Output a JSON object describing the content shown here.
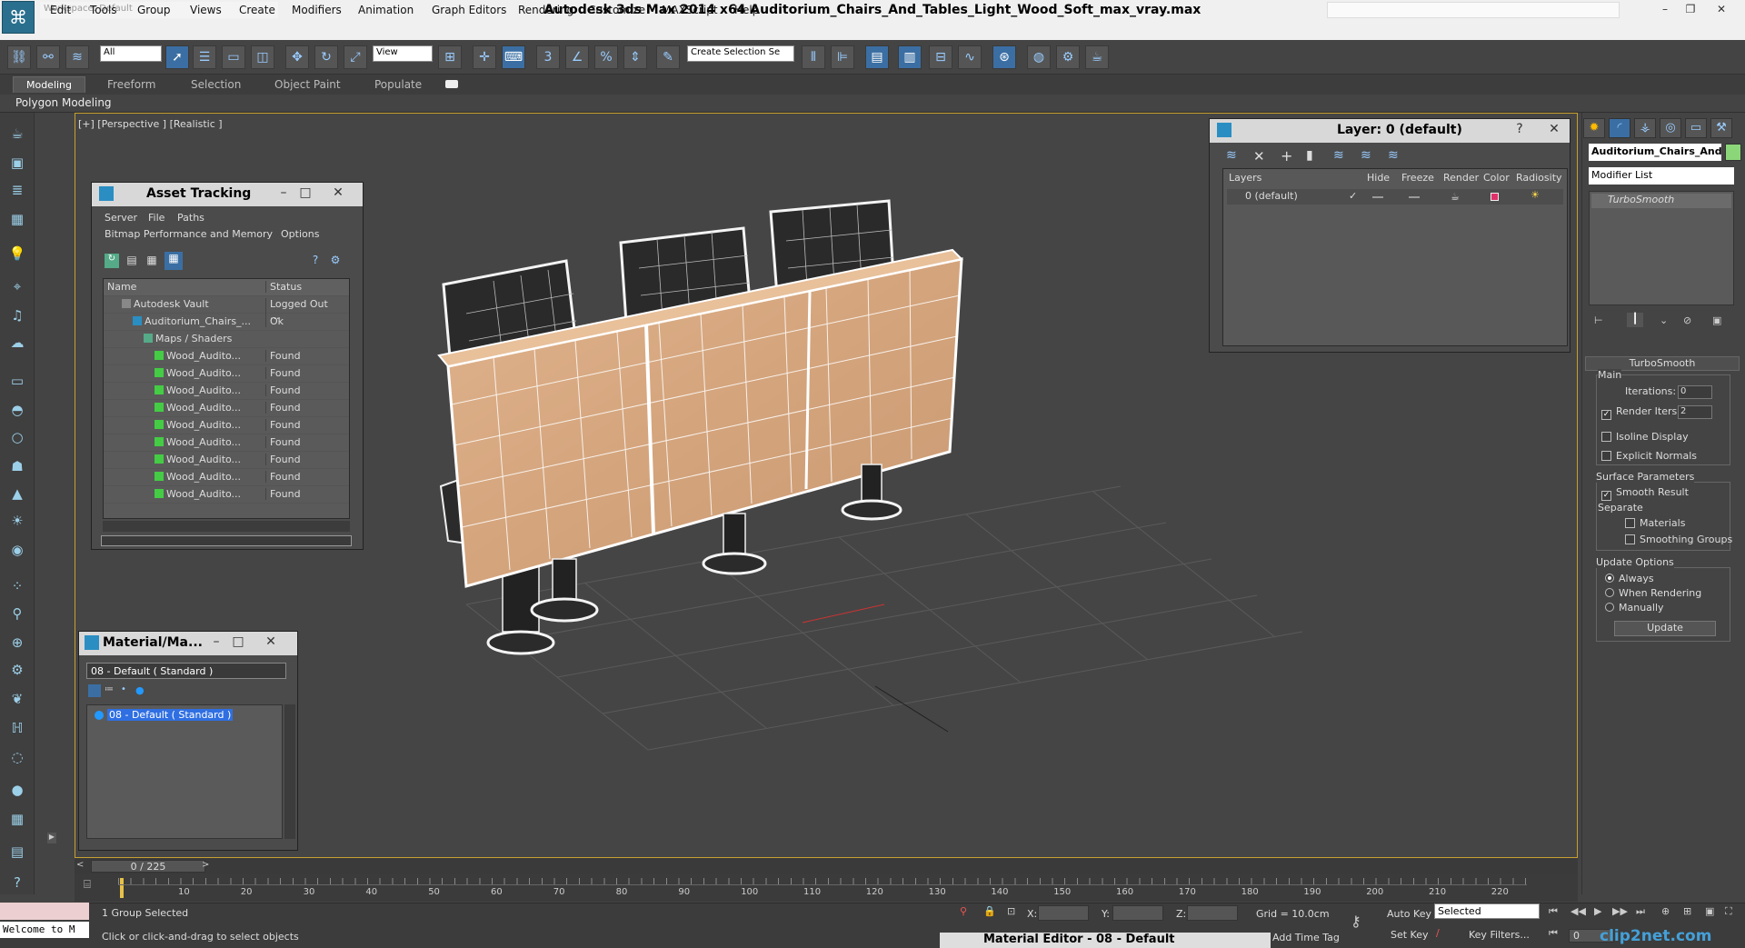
{
  "window": {
    "title": "Autodesk 3ds Max  2014 x64     Auditorium_Chairs_And_Tables_Light_Wood_Soft_max_vray.max",
    "workspace": "Workspace: Default",
    "controls": [
      "–",
      "❐",
      "✕"
    ]
  },
  "menubar": [
    "Edit",
    "Tools",
    "Group",
    "Views",
    "Create",
    "Modifiers",
    "Animation",
    "Graph Editors",
    "Rendering",
    "Customize",
    "MAXScript",
    "Help"
  ],
  "toolbar": {
    "selection_filter": "All",
    "reference_coord": "View",
    "named_selection": "Create Selection Se"
  },
  "ribbon": {
    "tabs": [
      "Modeling",
      "Freeform",
      "Selection",
      "Object Paint",
      "Populate"
    ],
    "active_tab": "Modeling",
    "subpanel": "Polygon Modeling"
  },
  "viewport": {
    "label": "[+] [Perspective ] [Realistic ]",
    "border_color": "#c8a030"
  },
  "asset_tracking": {
    "title": "Asset Tracking",
    "menu_row1": [
      "Server",
      "File",
      "Paths"
    ],
    "menu_row2": [
      "Bitmap Performance and Memory",
      "Options"
    ],
    "columns": [
      "Name",
      "Status"
    ],
    "rows": [
      {
        "name": "Autodesk Vault",
        "status": "Logged Out ...",
        "indent": 0
      },
      {
        "name": "Auditorium_Chairs_...",
        "status": "Ok",
        "indent": 1
      },
      {
        "name": "Maps / Shaders",
        "status": "",
        "indent": 2
      },
      {
        "name": "Wood_Audito...",
        "status": "Found",
        "indent": 3
      },
      {
        "name": "Wood_Audito...",
        "status": "Found",
        "indent": 3
      },
      {
        "name": "Wood_Audito...",
        "status": "Found",
        "indent": 3
      },
      {
        "name": "Wood_Audito...",
        "status": "Found",
        "indent": 3
      },
      {
        "name": "Wood_Audito...",
        "status": "Found",
        "indent": 3
      },
      {
        "name": "Wood_Audito...",
        "status": "Found",
        "indent": 3
      },
      {
        "name": "Wood_Audito...",
        "status": "Found",
        "indent": 3
      },
      {
        "name": "Wood_Audito...",
        "status": "Found",
        "indent": 3
      },
      {
        "name": "Wood_Audito...",
        "status": "Found",
        "indent": 3
      }
    ]
  },
  "material_browser": {
    "title": "Material/Ma...",
    "slot": "08 - Default  ( Standard )",
    "item": "08 - Default  ( Standard )"
  },
  "layer_panel": {
    "title": "Layer: 0 (default)",
    "help": "?",
    "columns": [
      "Layers",
      "Hide",
      "Freeze",
      "Render",
      "Color",
      "Radiosity"
    ],
    "row": {
      "name": "0 (default)",
      "check": "✓",
      "color": "#e0306a"
    }
  },
  "command_panel": {
    "object_name": "Auditorium_Chairs_And_",
    "object_color": "#8cd67a",
    "modifier_list": "Modifier List",
    "stack_item": "TurboSmooth",
    "rollout_title": "TurboSmooth",
    "main_label": "Main",
    "iterations_label": "Iterations:",
    "iterations_value": "0",
    "render_iters_label": "Render Iters:",
    "render_iters_value": "2",
    "isoline": "Isoline Display",
    "explicit_normals": "Explicit Normals",
    "surface_params": "Surface Parameters",
    "smooth_result": "Smooth Result",
    "separate": "Separate",
    "materials": "Materials",
    "smoothing_groups": "Smoothing Groups",
    "update_options": "Update Options",
    "always": "Always",
    "when_rendering": "When Rendering",
    "manually": "Manually",
    "update_button": "Update"
  },
  "timeline": {
    "readout": "0 / 225",
    "ticks": [
      "10",
      "20",
      "30",
      "40",
      "50",
      "60",
      "70",
      "80",
      "90",
      "100",
      "110",
      "120",
      "130",
      "140",
      "150",
      "160",
      "170",
      "180",
      "190",
      "200",
      "210",
      "220"
    ]
  },
  "status": {
    "welcome": "Welcome to M",
    "selection_info": "1 Group Selected",
    "prompt": "Click or click-and-drag to select objects",
    "x_label": "X:",
    "y_label": "Y:",
    "z_label": "Z:",
    "grid": "Grid = 10.0cm",
    "auto_key": "Auto Key",
    "set_key": "Set Key",
    "selected": "Selected",
    "key_filters": "Key Filters...",
    "time_tag": "Add Time Tag",
    "frame": "0",
    "material_editor_tab": "Material Editor - 08 - Default",
    "watermark": "clip2net.com"
  }
}
